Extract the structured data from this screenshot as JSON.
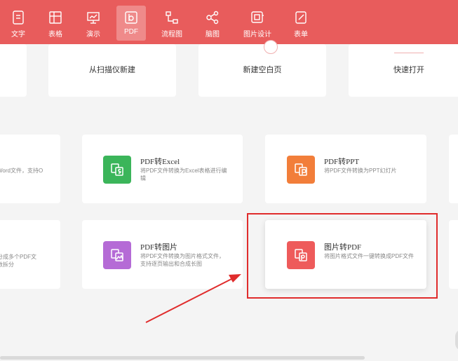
{
  "toolbar": {
    "tabs": [
      {
        "label": "文字",
        "icon": "text-doc-icon"
      },
      {
        "label": "表格",
        "icon": "table-icon"
      },
      {
        "label": "演示",
        "icon": "presentation-icon"
      },
      {
        "label": "PDF",
        "icon": "pdf-icon",
        "active": true
      },
      {
        "label": "流程图",
        "icon": "flowchart-icon"
      },
      {
        "label": "脑图",
        "icon": "mindmap-icon"
      },
      {
        "label": "图片设计",
        "icon": "image-design-icon"
      },
      {
        "label": "表单",
        "icon": "form-icon"
      }
    ]
  },
  "create_cards": {
    "scan": "从扫描仪新建",
    "blank": "新建空白页",
    "quick_open": "快速打开"
  },
  "tools": {
    "left_partial_1": "Word文件，支持O",
    "pdf_to_excel": {
      "title": "PDF转Excel",
      "desc": "将PDF文件转换为Excel表格进行编辑",
      "color": "#3bb55a"
    },
    "pdf_to_ppt": {
      "title": "PDF转PPT",
      "desc": "将PDF文件转换为PPT幻灯片",
      "color": "#f27e3a"
    },
    "left_partial_2a": "分成多个PDF文",
    "left_partial_2b": "数拆分",
    "pdf_to_image": {
      "title": "PDF转图片",
      "desc": "将PDF文件转换为图片格式文件，支持逐页输出和合成长图",
      "color": "#b56bd6"
    },
    "image_to_pdf": {
      "title": "图片转PDF",
      "desc": "将图片格式文件一键转换成PDF文件",
      "color": "#ee5b5b"
    }
  },
  "annotation": {
    "highlight_color": "#e02c2c"
  }
}
